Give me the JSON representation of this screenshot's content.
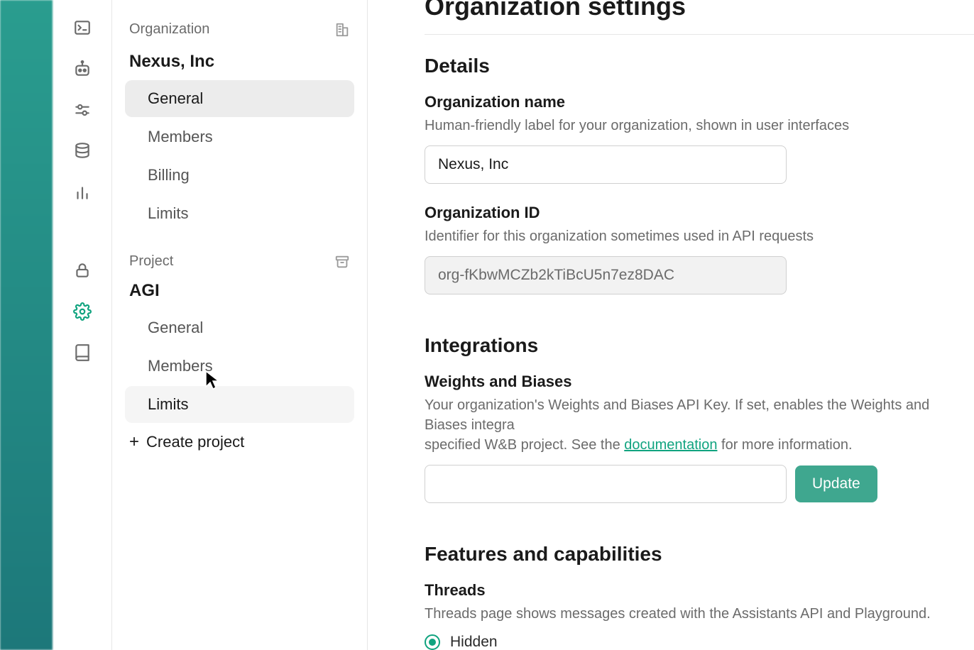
{
  "sidebar": {
    "org_section_label": "Organization",
    "org_name": "Nexus, Inc",
    "org_items": [
      {
        "label": "General",
        "active": true
      },
      {
        "label": "Members"
      },
      {
        "label": "Billing"
      },
      {
        "label": "Limits"
      }
    ],
    "project_section_label": "Project",
    "project_name": "AGI",
    "project_items": [
      {
        "label": "General"
      },
      {
        "label": "Members"
      },
      {
        "label": "Limits",
        "hover": true
      }
    ],
    "create_project_label": "Create project"
  },
  "page": {
    "title": "Organization settings"
  },
  "details": {
    "heading": "Details",
    "org_name_label": "Organization name",
    "org_name_help": "Human-friendly label for your organization, shown in user interfaces",
    "org_name_value": "Nexus, Inc",
    "org_id_label": "Organization ID",
    "org_id_help": "Identifier for this organization sometimes used in API requests",
    "org_id_value": "org-fKbwMCZb2kTiBcU5n7ez8DAC"
  },
  "integrations": {
    "heading": "Integrations",
    "wandb_label": "Weights and Biases",
    "wandb_help_prefix": "Your organization's Weights and Biases API Key. If set, enables the Weights and Biases integra",
    "wandb_help_mid": "specified W&B project. See the ",
    "wandb_doc_link": "documentation",
    "wandb_help_suffix": " for more information.",
    "wandb_value": "",
    "update_button": "Update"
  },
  "features": {
    "heading": "Features and capabilities",
    "threads_label": "Threads",
    "threads_help": "Threads page shows messages created with the Assistants API and Playground.",
    "threads_option_hidden": "Hidden"
  }
}
